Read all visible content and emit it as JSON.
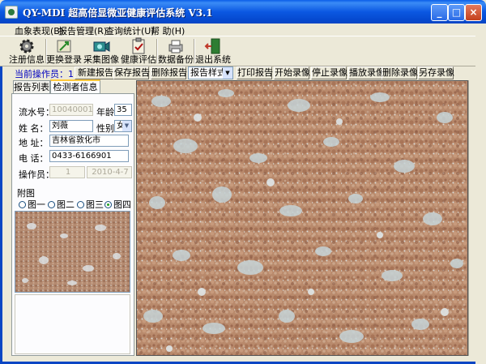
{
  "window": {
    "title": "QY-MDI 超高倍显微亚健康评估系统 V3.1",
    "min_label": "_",
    "max_label": "□",
    "close_label": "×"
  },
  "menu": [
    {
      "label": "血象表现(B)"
    },
    {
      "label": "报告管理(R)"
    },
    {
      "label": "查询统计(U)"
    },
    {
      "label": "帮 助(H)"
    }
  ],
  "toolbar": [
    {
      "label": "注册信息",
      "icon": "gear-icon"
    },
    {
      "label": "更换登录",
      "icon": "user-switch-icon"
    },
    {
      "label": "采集图像",
      "icon": "camera-icon"
    },
    {
      "label": "健康评估",
      "icon": "clipboard-check-icon"
    },
    {
      "label": "数据备份",
      "icon": "printer-backup-icon"
    },
    {
      "label": "退出系统",
      "icon": "exit-door-icon"
    }
  ],
  "actions": {
    "operator_label": "当前操作员：1",
    "buttons": [
      "新建报告",
      "保存报告",
      "删除报告",
      "打印报告",
      "开始录像",
      "停止录像",
      "播放录像",
      "删除录像",
      "另存录像"
    ],
    "template_select": "报告样式一"
  },
  "tabs": [
    {
      "label": "报告列表"
    },
    {
      "label": "检测者信息"
    }
  ],
  "form": {
    "serial_label": "流水号：",
    "serial_value": "10040001",
    "age_label": "年龄：",
    "age_value": "35",
    "name_label": "姓  名：",
    "name_value": "刘薇",
    "gender_label": "性别：",
    "gender_value": "女",
    "address_label": "地  址：",
    "address_value": "吉林省敦化市",
    "phone_label": "电  话：",
    "phone_value": "0433-6166901",
    "operator_label": "操作员：",
    "operator_value": "1",
    "date_value": "2010-4-7"
  },
  "attached": {
    "legend": "附图",
    "options": [
      "图一",
      "图二",
      "图三",
      "图四"
    ],
    "selected": "图四"
  },
  "colors": {
    "titlebar": "#0a5de9",
    "operator_text": "#0000c0",
    "cell_base": "#b98a6c",
    "plasma": "#c6d4d8"
  }
}
